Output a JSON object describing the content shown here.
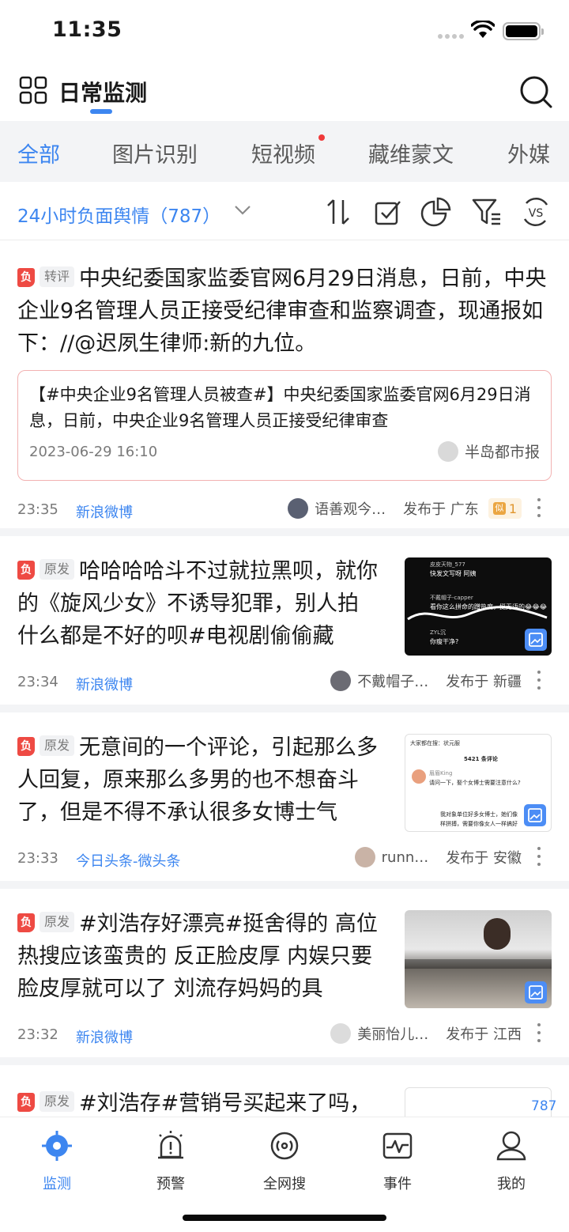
{
  "status_bar": {
    "time": "11:35"
  },
  "header": {
    "title": "日常监测"
  },
  "tabs": [
    {
      "label": "全部"
    },
    {
      "label": "图片识别"
    },
    {
      "label": "短视频"
    },
    {
      "label": "藏维蒙文"
    },
    {
      "label": "外媒"
    }
  ],
  "filter": {
    "label": "24小时负面舆情（787）"
  },
  "badges": {
    "negative": "负"
  },
  "items": [
    {
      "type": "转评",
      "text": "中央纪委国家监委官网6月29日消息，日前，中央企业9名管理人员正接受纪律审查和监察调查，现通报如下：//@迟夙生律师:新的九位。",
      "quote": {
        "text": "【#中央企业9名管理人员被查#】中央纪委国家监委官网6月29日消息，日前，中央企业9名管理人员正接受纪律审查",
        "date": "2023-06-29 16:10",
        "source": "半岛都市报"
      },
      "time": "23:35",
      "source": "新浪微博",
      "author": "语善观今…",
      "region": "发布于 广东",
      "similar_label": "似",
      "similar_count": "1"
    },
    {
      "type": "原发",
      "text": "哈哈哈哈斗不过就拉黑呗，就你的《旋风少女》不诱导犯罪，别人拍什么都是不好的呗#电视剧偷偷藏",
      "time": "23:34",
      "source": "新浪微博",
      "author": "不戴帽子…",
      "region": "发布于 新疆"
    },
    {
      "type": "原发",
      "text": "无意间的一个评论，引起那么多人回复，原来那么多男的也不想奋斗了，但是不得不承认很多女博士气",
      "time": "23:33",
      "source": "今日头条-微头条",
      "author": "runn…",
      "region": "发布于 安徽"
    },
    {
      "type": "原发",
      "text": "#刘浩存好漂亮#挺舍得的 高位热搜应该蛮贵的 反正脸皮厚 内娱只要脸皮厚就可以了 刘流存妈妈的具",
      "time": "23:32",
      "source": "新浪微博",
      "author": "美丽怡儿…",
      "region": "发布于 江西"
    },
    {
      "type": "原发",
      "text": "#刘浩存#营销号买起来了吗，"
    }
  ],
  "thumbs": {
    "t1": {
      "line1": "皮皮天物_577",
      "line2": "快发文写呀 阿姨",
      "line3": "不戴帽子-capper",
      "line4": "看你这么拼命的蹭热度，挺无语的😂😂😂",
      "line5": "ZYL沉",
      "line6": "你瘦干净?"
    },
    "t2": {
      "line1": "大家都在搜：状元服",
      "line2": "5421 条评论",
      "line3": "眉眉King",
      "line4": "请问一下，娶个女博士需要注意什么?",
      "line5": "我对象单位好多女博士，她们像",
      "line6": "样拼搏，需要你像女人一样搞好"
    }
  },
  "count_bubble": "787",
  "bottom_nav": [
    {
      "label": "监测"
    },
    {
      "label": "预警"
    },
    {
      "label": "全网搜"
    },
    {
      "label": "事件"
    },
    {
      "label": "我的"
    }
  ],
  "colors": {
    "accent": "#3d86f0",
    "negative": "#ee4a43",
    "tab_bg": "#f3f4f6"
  }
}
